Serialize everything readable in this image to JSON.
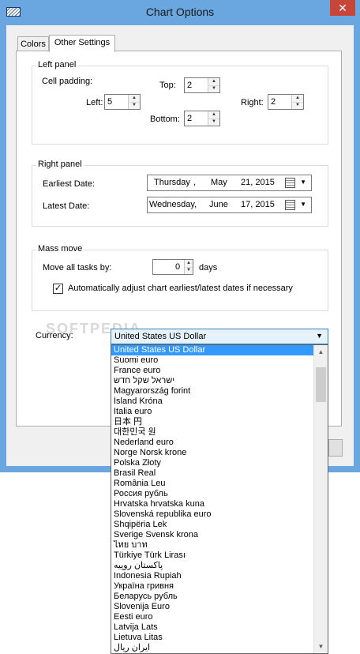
{
  "window": {
    "title": "Chart Options",
    "close_glyph": "✕"
  },
  "tabs": [
    {
      "label": "Colors"
    },
    {
      "label": "Other Settings"
    }
  ],
  "left_panel": {
    "legend": "Left panel",
    "cell_padding_label": "Cell padding:",
    "top": {
      "label": "Top:",
      "value": "2"
    },
    "left": {
      "label": "Left:",
      "value": "5"
    },
    "right": {
      "label": "Right:",
      "value": "2"
    },
    "bottom": {
      "label": "Bottom:",
      "value": "2"
    }
  },
  "right_panel": {
    "legend": "Right panel",
    "earliest": {
      "label": "Earliest Date:",
      "weekday": "Thursday",
      "month": "May",
      "day_year": "21, 2015"
    },
    "latest": {
      "label": "Latest Date:",
      "weekday": "Wednesday,",
      "month": "June",
      "day_year": "17, 2015"
    },
    "comma": ","
  },
  "mass_move": {
    "legend": "Mass move",
    "move_label": "Move all tasks by:",
    "move_value": "0",
    "days_label": "days",
    "auto_adjust": {
      "checked": true,
      "check_glyph": "✓",
      "label": "Automatically adjust chart earliest/latest dates if necessary"
    }
  },
  "currency": {
    "label": "Currency:",
    "selected": "United States US Dollar",
    "options": [
      "United States US Dollar",
      "Suomi euro",
      "France euro",
      "ישראל שקל חדש",
      "Magyarország forint",
      "Ísland Króna",
      "Italia euro",
      "日本 円",
      "대한민국 원",
      "Nederland euro",
      "Norge Norsk krone",
      "Polska Złoty",
      "Brasil Real",
      "România Leu",
      "Россия рубль",
      "Hrvatska hrvatska kuna",
      "Slovenská republika euro",
      "Shqipëria Lek",
      "Sverige Svensk krona",
      "ไทย บาท",
      "Türkiye Türk Lirası",
      "پاکستان روپیه",
      "Indonesia Rupiah",
      "Україна гривня",
      "Беларусь рубль",
      "Slovenija Euro",
      "Eesti euro",
      "Latvija Lats",
      "Lietuva Litas",
      "ایران ریال"
    ]
  },
  "icons": {
    "spin_up": "▲",
    "spin_down": "▼",
    "dropdown_arrow": "▼",
    "scroll_up": "▲",
    "scroll_down": "▼"
  },
  "watermark": "SOFTPEDIA",
  "colors": {
    "title_bar": "#6aa6e0",
    "close_button": "#c7463a",
    "selection": "#3399ff"
  }
}
